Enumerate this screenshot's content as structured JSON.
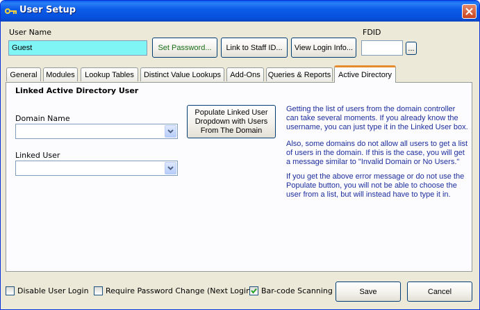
{
  "window": {
    "title": "User Setup"
  },
  "header": {
    "user_name_label": "User Name",
    "user_name_value": "Guest",
    "set_password_label": "Set Password...",
    "link_staff_label": "Link to Staff ID...",
    "view_login_label": "View Login Info...",
    "fdid_label": "FDID",
    "fdid_value": "",
    "fdid_browse_label": "..."
  },
  "tabs": [
    {
      "label": "General"
    },
    {
      "label": "Modules"
    },
    {
      "label": "Lookup Tables"
    },
    {
      "label": "Distinct Value Lookups"
    },
    {
      "label": "Add-Ons"
    },
    {
      "label": "Queries & Reports"
    },
    {
      "label": "Active Directory",
      "active": true
    }
  ],
  "active_directory": {
    "section_title": "Linked Active Directory User",
    "domain_name_label": "Domain Name",
    "domain_name_value": "",
    "linked_user_label": "Linked User",
    "linked_user_value": "",
    "populate_button_label": "Populate Linked User Dropdown with Users From The Domain",
    "info_paragraphs": [
      "Getting the list of users from the domain controller can take several moments.  If you already know the username, you can just type it in the Linked User box.",
      "Also, some domains do not allow all users to get a list of users in the domain.  If this is the case, you will get a message similar to \"Invalid Domain or No Users.\"",
      "If you get the above error message or do not use the Populate button, you will not be able to choose the user from a list, but will instead have to type it in."
    ]
  },
  "footer": {
    "disable_login": {
      "label": "Disable User Login",
      "checked": false
    },
    "require_password": {
      "label": "Require Password Change (Next Login)",
      "checked": false
    },
    "barcode": {
      "label": "Bar-code Scanning",
      "checked": true
    },
    "save_label": "Save",
    "cancel_label": "Cancel"
  },
  "colors": {
    "title_bar": "#0a5fef",
    "user_name_field": "#7ff5f5",
    "info_text": "#1c2d9c",
    "active_tab_accent": "#e68b2c"
  },
  "icons": {
    "window_icon": "key-icon",
    "close": "close-icon",
    "combo_arrow": "chevron-down-icon"
  }
}
